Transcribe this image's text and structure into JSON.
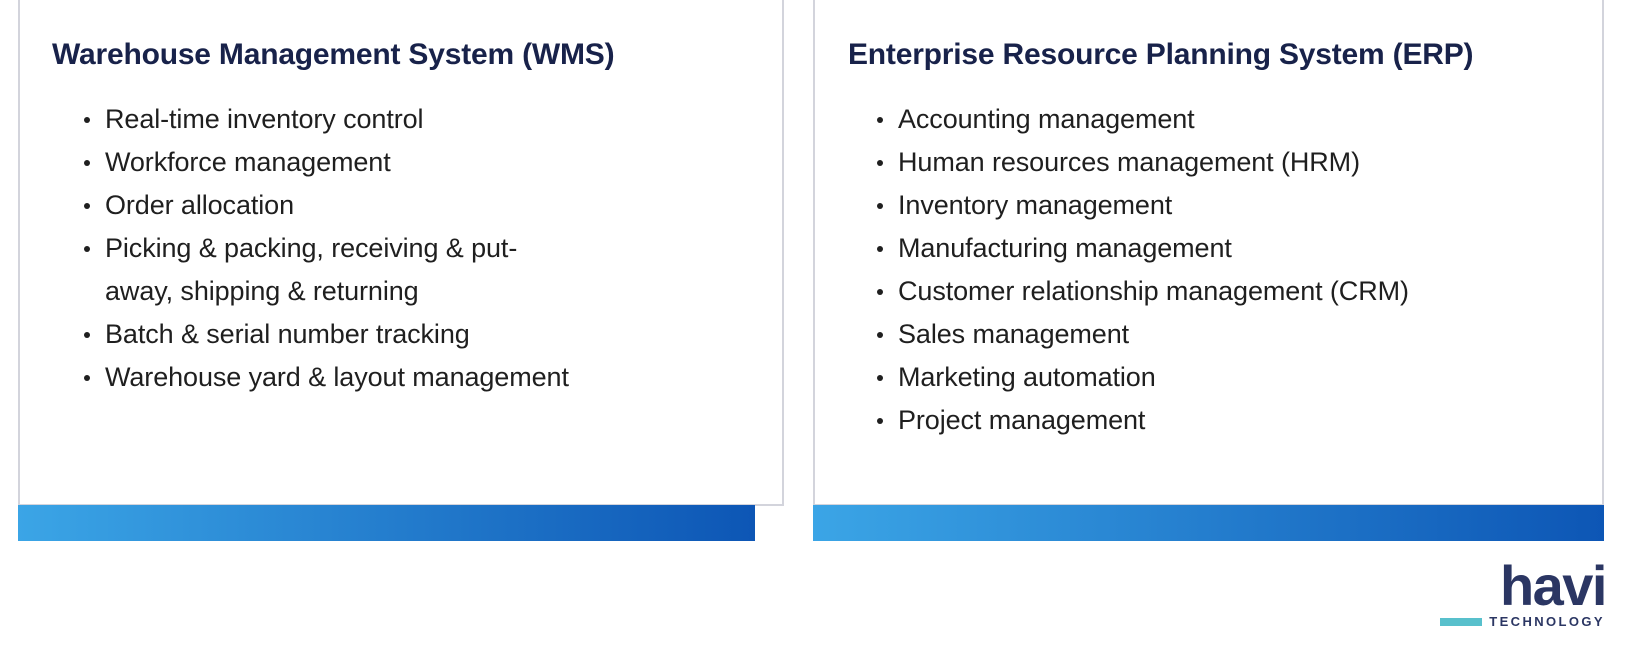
{
  "slide": {
    "background_color": "#ffffff",
    "cards": [
      {
        "id": "wms",
        "title": "Warehouse Management System (WMS)",
        "title_color": "#18224a",
        "border_color": "#d3d4dc",
        "items": [
          "Real-time inventory control",
          "Workforce management",
          "Order allocation",
          "Picking & packing, receiving & put-away, shipping & returning",
          "Batch & serial number tracking",
          "Warehouse yard & layout management"
        ],
        "accent_bar": {
          "gradient_from": "#3ba5e6",
          "gradient_to": "#0d56b5"
        }
      },
      {
        "id": "erp",
        "title": "Enterprise Resource Planning System (ERP)",
        "title_color": "#18224a",
        "border_color": "#d3d4dc",
        "items": [
          "Accounting management",
          "Human resources management (HRM)",
          "Inventory management",
          "Manufacturing management",
          "Customer relationship management (CRM)",
          "Sales management",
          "Marketing automation",
          "Project management"
        ],
        "accent_bar": {
          "gradient_from": "#3ba5e6",
          "gradient_to": "#0d56b5"
        }
      }
    ]
  },
  "logo": {
    "wordmark": "havi",
    "tagline": "TECHNOLOGY",
    "wordmark_color": "#2b3663",
    "dash_color": "#58c0cc"
  }
}
